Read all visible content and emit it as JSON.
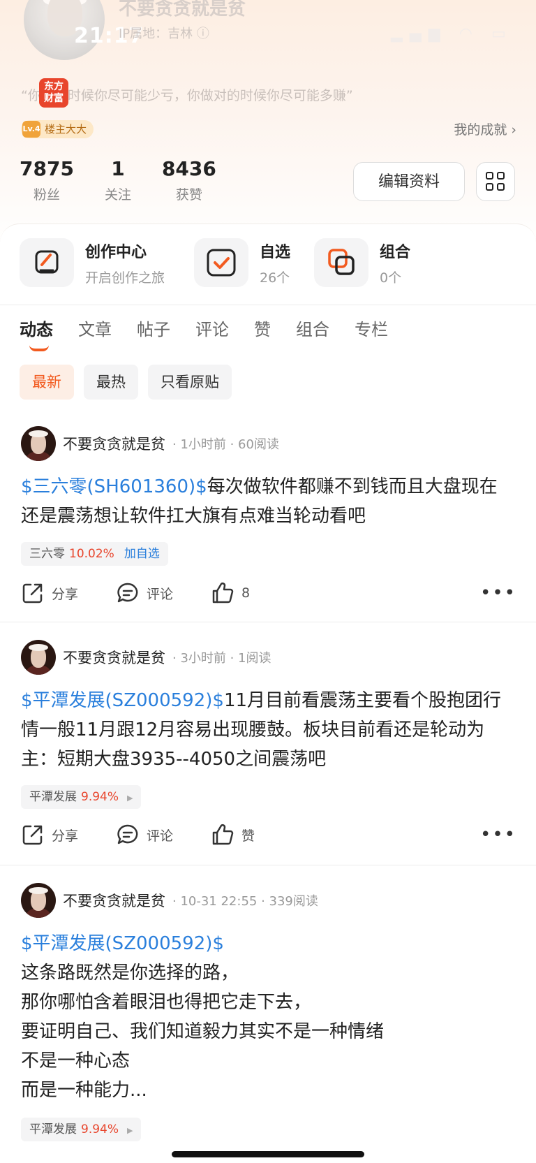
{
  "status_bar": {
    "time": "21:17"
  },
  "profile": {
    "username": "不要贪贪就是贫",
    "ip_location": "IP属地：吉林",
    "brand": "东方\n财富",
    "motto": "“你错的时候你尽可能少亏，你做对的时候你尽可能多赚”",
    "level_icon": "Lv.4",
    "level_label": "楼主大大",
    "achievement": "我的成就",
    "stats": [
      {
        "value": "7875",
        "label": "粉丝"
      },
      {
        "value": "1",
        "label": "关注"
      },
      {
        "value": "8436",
        "label": "获赞"
      }
    ],
    "edit_label": "编辑资料"
  },
  "features": [
    {
      "title": "创作中心",
      "sub": "开启创作之旅"
    },
    {
      "title": "自选",
      "sub": "26个"
    },
    {
      "title": "组合",
      "sub": "0个"
    }
  ],
  "tabs": [
    "动态",
    "文章",
    "帖子",
    "评论",
    "赞",
    "组合",
    "专栏"
  ],
  "filters": [
    "最新",
    "最热",
    "只看原贴"
  ],
  "posts": [
    {
      "author": "不要贪贪就是贫",
      "meta": "· 1小时前 · 60阅读",
      "stock_tag": "$三六零(SH601360)$",
      "text": "每次做软件都赚不到钱而且大盘现在还是震荡想让软件扛大旗有点难当轮动看吧",
      "chip_name": "三六零",
      "chip_pct": "10.02%",
      "chip_add": "加自选",
      "share": "分享",
      "comment": "评论",
      "like": "8"
    },
    {
      "author": "不要贪贪就是贫",
      "meta": "· 3小时前 · 1阅读",
      "stock_tag": "$平潭发展(SZ000592)$",
      "text": "11月目前看震荡主要看个股抱团行情一般11月跟12月容易出现腰鼓。板块目前看还是轮动为主：短期大盘3935--4050之间震荡吧",
      "chip_name": "平潭发展",
      "chip_pct": "9.94%",
      "share": "分享",
      "comment": "评论",
      "like": "赞"
    },
    {
      "author": "不要贪贪就是贫",
      "meta": "· 10-31 22:55 · 339阅读",
      "stock_tag": "$平潭发展(SZ000592)$",
      "lines": [
        "这条路既然是你选择的路，",
        "那你哪怕含着眼泪也得把它走下去，",
        "要证明自己、我们知道毅力其实不是一种情绪",
        "不是一种心态",
        "而是一种能力..."
      ],
      "chip_name": "平潭发展",
      "chip_pct": "9.94%"
    }
  ]
}
